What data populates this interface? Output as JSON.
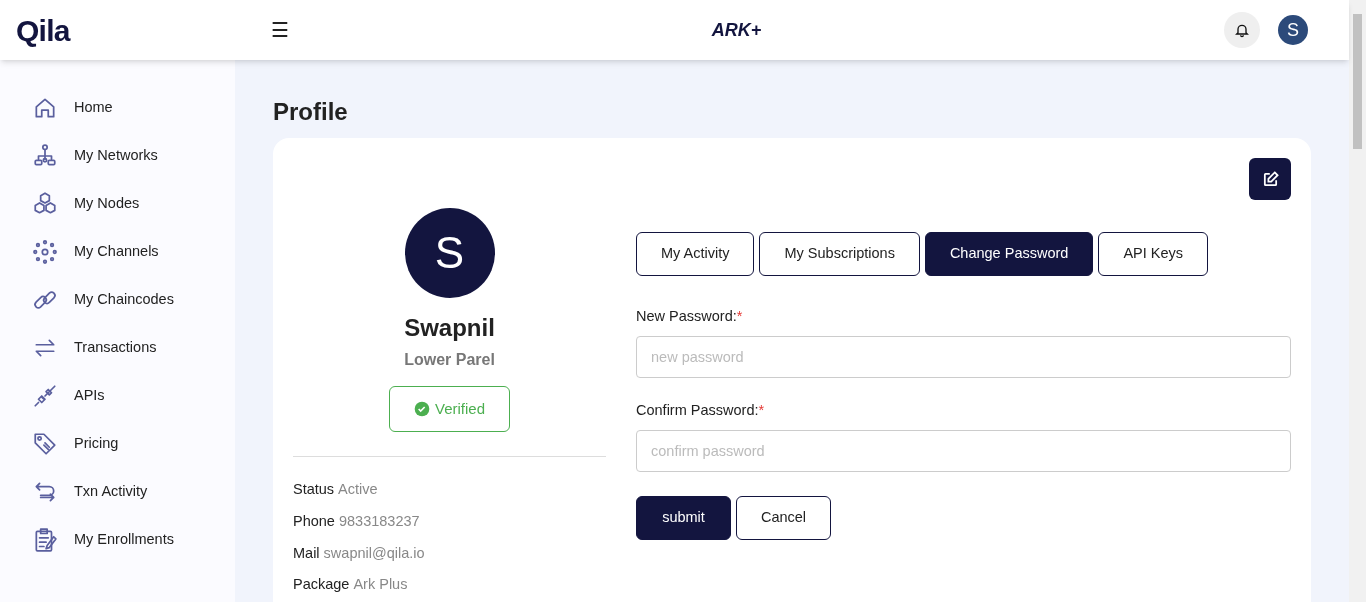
{
  "header": {
    "logo": "Qila",
    "menu_icon": "☰",
    "brand": "ARK+",
    "avatar": "S"
  },
  "sidebar": {
    "items": [
      {
        "label": "Home"
      },
      {
        "label": "My Networks"
      },
      {
        "label": "My Nodes"
      },
      {
        "label": "My Channels"
      },
      {
        "label": "My Chaincodes"
      },
      {
        "label": "Transactions"
      },
      {
        "label": "APIs"
      },
      {
        "label": "Pricing"
      },
      {
        "label": "Txn Activity"
      },
      {
        "label": "My Enrollments"
      }
    ]
  },
  "page_title": "Profile",
  "profile": {
    "avatar": "S",
    "name": "Swapnil",
    "location": "Lower Parel",
    "badge": "Verified",
    "verified": true,
    "details": [
      {
        "label": "Status",
        "value": "Active"
      },
      {
        "label": "Phone",
        "value": "9833183237"
      },
      {
        "label": "Mail",
        "value": "swapnil@qila.io"
      },
      {
        "label": "Package",
        "value": "Ark Plus"
      }
    ]
  },
  "tabs": [
    {
      "label": "My Activity",
      "selected": false
    },
    {
      "label": "My Subscriptions",
      "selected": false
    },
    {
      "label": "Change Password",
      "selected": true
    },
    {
      "label": "API Keys",
      "selected": false
    }
  ],
  "form": {
    "fields": [
      {
        "label": "New Password:",
        "required_mark": "*",
        "placeholder": "new password"
      },
      {
        "label": "Confirm Password:",
        "required_mark": "*",
        "placeholder": "confirm password"
      }
    ],
    "buttons": [
      {
        "label": "submit",
        "kind": "primary"
      },
      {
        "label": "Cancel",
        "kind": "secondary"
      }
    ]
  }
}
